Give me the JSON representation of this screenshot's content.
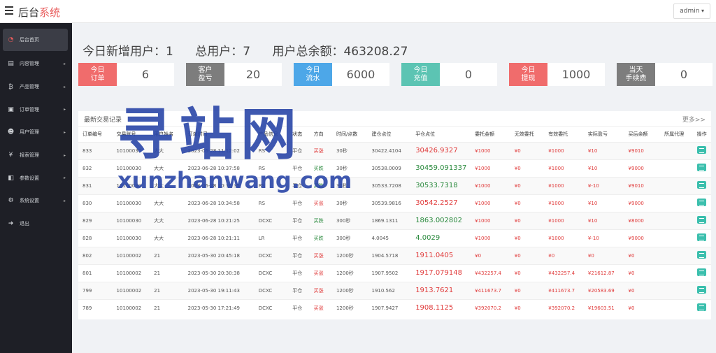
{
  "app": {
    "brand_main": "后台",
    "brand_accent": "系统",
    "user_menu": "admin"
  },
  "sidebar": {
    "items": [
      {
        "label": "后台首页",
        "icon": "dashboard-icon",
        "glyph": "◔"
      },
      {
        "label": "内容管理",
        "icon": "content-icon",
        "glyph": "▤"
      },
      {
        "label": "产品管理",
        "icon": "bitcoin-icon",
        "glyph": "₿"
      },
      {
        "label": "订单管理",
        "icon": "order-icon",
        "glyph": "▣"
      },
      {
        "label": "用户管理",
        "icon": "user-icon",
        "glyph": "☻"
      },
      {
        "label": "报表管理",
        "icon": "yen-icon",
        "glyph": "¥"
      },
      {
        "label": "参数设置",
        "icon": "params-icon",
        "glyph": "◧"
      },
      {
        "label": "系统设置",
        "icon": "gears-icon",
        "glyph": "⚙"
      },
      {
        "label": "退出",
        "icon": "logout-icon",
        "glyph": "➜"
      }
    ]
  },
  "summary": {
    "today_new_users": "今日新增用户：1",
    "total_users": "总用户：7",
    "total_balance": "用户总余额：463208.27"
  },
  "stats": [
    {
      "label": "今日\n订单",
      "value": "6",
      "color": "#f06c6c"
    },
    {
      "label": "客户\n盈亏",
      "value": "20",
      "color": "#7d7d7d"
    },
    {
      "label": "今日\n流水",
      "value": "6000",
      "color": "#4da7e8"
    },
    {
      "label": "今日\n充值",
      "value": "0",
      "color": "#5cc4b3"
    },
    {
      "label": "今日\n提现",
      "value": "1000",
      "color": "#f06c6c"
    },
    {
      "label": "当天\n手续费",
      "value": "0",
      "color": "#7d7d7d"
    }
  ],
  "trades": {
    "title": "最新交易记录",
    "more": "更多>>",
    "columns": [
      "订单编号",
      "交易账号",
      "用户姓名",
      "订单时间",
      "产品信息",
      "状态",
      "方向",
      "时间/点数",
      "建仓点位",
      "平仓点位",
      "委托金额",
      "无效委托",
      "有效委托",
      "实际盈亏",
      "买后余额",
      "所属代理",
      "操作"
    ],
    "rows": [
      [
        "833",
        "10100030",
        "大大",
        "2023-06-28 11:12:02",
        "RS",
        "平仓",
        "买涨",
        "30秒",
        "30422.4104",
        "30426.9327",
        "¥1000",
        "¥0",
        "¥1000",
        "¥10",
        "¥9010",
        ""
      ],
      [
        "832",
        "10100030",
        "大大",
        "2023-06-28 10:37:58",
        "RS",
        "平仓",
        "买跌",
        "30秒",
        "30538.0009",
        "30459.091337",
        "¥1000",
        "¥0",
        "¥1000",
        "¥10",
        "¥9000",
        ""
      ],
      [
        "831",
        "10100030",
        "大大",
        "2023-06-28 10:36:35",
        "RS",
        "平仓",
        "买跌",
        "30秒",
        "30533.7208",
        "30533.7318",
        "¥1000",
        "¥0",
        "¥1000",
        "¥-10",
        "¥9010",
        ""
      ],
      [
        "830",
        "10100030",
        "大大",
        "2023-06-28 10:34:58",
        "RS",
        "平仓",
        "买涨",
        "30秒",
        "30539.9816",
        "30542.2527",
        "¥1000",
        "¥0",
        "¥1000",
        "¥10",
        "¥9000",
        ""
      ],
      [
        "829",
        "10100030",
        "大大",
        "2023-06-28 10:21:25",
        "DCXC",
        "平仓",
        "买跌",
        "300秒",
        "1869.1311",
        "1863.002802",
        "¥1000",
        "¥0",
        "¥1000",
        "¥10",
        "¥8000",
        ""
      ],
      [
        "828",
        "10100030",
        "大大",
        "2023-06-28 10:21:11",
        "LR",
        "平仓",
        "买跌",
        "300秒",
        "4.0045",
        "4.0029",
        "¥1000",
        "¥0",
        "¥1000",
        "¥-10",
        "¥9000",
        ""
      ],
      [
        "802",
        "10100002",
        "21",
        "2023-05-30 20:45:18",
        "DCXC",
        "平仓",
        "买涨",
        "1200秒",
        "1904.5718",
        "1911.0405",
        "¥0",
        "¥0",
        "¥0",
        "¥0",
        "¥0",
        ""
      ],
      [
        "801",
        "10100002",
        "21",
        "2023-05-30 20:30:38",
        "DCXC",
        "平仓",
        "买涨",
        "1200秒",
        "1907.9502",
        "1917.079148",
        "¥432257.4",
        "¥0",
        "¥432257.4",
        "¥21612.87",
        "¥0",
        ""
      ],
      [
        "799",
        "10100002",
        "21",
        "2023-05-30 19:11:43",
        "DCXC",
        "平仓",
        "买涨",
        "1200秒",
        "1910.562",
        "1913.7621",
        "¥411673.7",
        "¥0",
        "¥411673.7",
        "¥20583.69",
        "¥0",
        ""
      ],
      [
        "789",
        "10100002",
        "21",
        "2023-05-30 17:21:49",
        "DCXC",
        "平仓",
        "买涨",
        "1200秒",
        "1907.9427",
        "1908.1125",
        "¥392070.2",
        "¥0",
        "¥392070.2",
        "¥19603.51",
        "¥0",
        ""
      ]
    ]
  },
  "watermark": {
    "cn": "寻站网",
    "en": "xunzhanwang.com"
  }
}
